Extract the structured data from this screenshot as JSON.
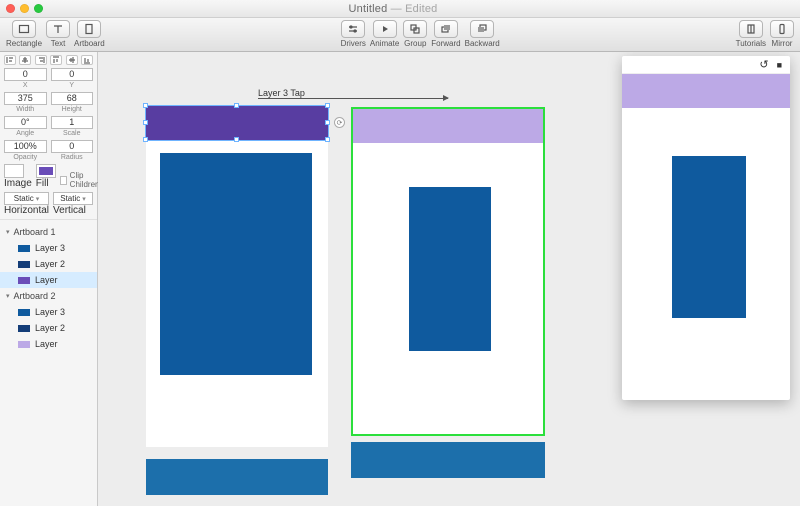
{
  "window": {
    "title": "Untitled",
    "edited": "— Edited"
  },
  "toolbar": {
    "rectangle": "Rectangle",
    "text": "Text",
    "artboard": "Artboard",
    "drivers": "Drivers",
    "animate": "Animate",
    "group": "Group",
    "forward": "Forward",
    "backward": "Backward",
    "tutorials": "Tutorials",
    "mirror": "Mirror"
  },
  "inspector": {
    "x": {
      "value": "0",
      "label": "X"
    },
    "y": {
      "value": "0",
      "label": "Y"
    },
    "width": {
      "value": "375",
      "label": "Width"
    },
    "height": {
      "value": "68",
      "label": "Height"
    },
    "angle": {
      "value": "0°",
      "label": "Angle"
    },
    "scale": {
      "value": "1",
      "label": "Scale"
    },
    "opacity": {
      "value": "100%",
      "label": "Opacity"
    },
    "radius": {
      "value": "0",
      "label": "Radius"
    },
    "image": "Image",
    "fill": "Fill",
    "clip": "Clip Children",
    "static_h": {
      "value": "Static",
      "label": "Horizontal"
    },
    "static_v": {
      "value": "Static",
      "label": "Vertical"
    }
  },
  "layers": {
    "artboards": [
      {
        "name": "Artboard 1",
        "items": [
          {
            "name": "Layer 3",
            "color": "darkblue"
          },
          {
            "name": "Layer 2",
            "color": "navy"
          },
          {
            "name": "Layer",
            "color": "purple",
            "selected": true
          }
        ]
      },
      {
        "name": "Artboard 2",
        "items": [
          {
            "name": "Layer 3",
            "color": "darkblue"
          },
          {
            "name": "Layer 2",
            "color": "navy"
          },
          {
            "name": "Layer",
            "color": "lpurple"
          }
        ]
      }
    ]
  },
  "canvas": {
    "animation_label": "Layer 3 Tap",
    "colors": {
      "purple": "#583da1",
      "lightpurple": "#bca9e6",
      "blue": "#0f5a9e",
      "bar": "#1c6fab",
      "selection": "#2bdf3c"
    }
  },
  "preview": {
    "undo_icon": "undo-icon",
    "record_icon": "record-icon"
  }
}
